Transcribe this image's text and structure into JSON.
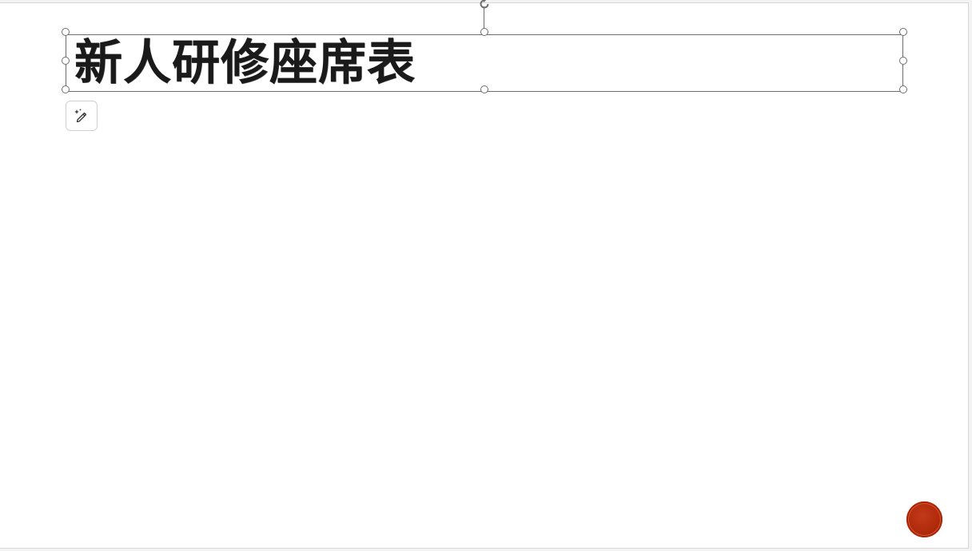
{
  "slide": {
    "title": "新人研修座席表"
  },
  "icons": {
    "rotate": "rotate-arrow-icon",
    "designer": "pen-sparkle-icon",
    "seal": "red-seal-logo"
  },
  "colors": {
    "selection_border": "#6e6e6e",
    "seal_red": "#b02a0c",
    "title_text": "#1a1a1a"
  }
}
